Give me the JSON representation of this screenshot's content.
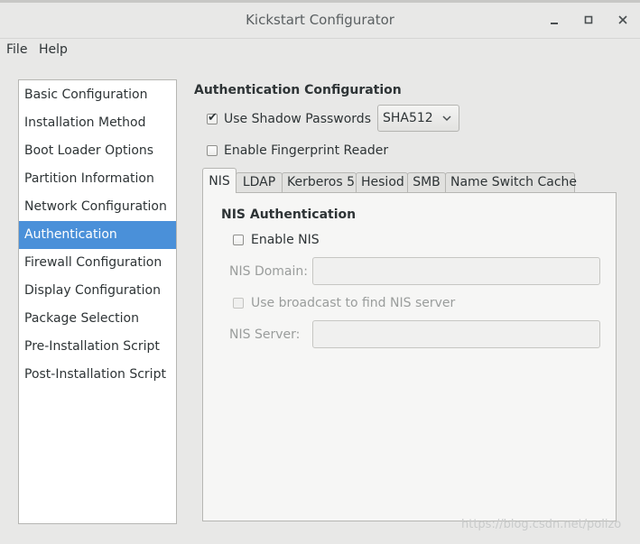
{
  "window": {
    "title": "Kickstart Configurator"
  },
  "menu": [
    "File",
    "Help"
  ],
  "sidebar": {
    "items": [
      {
        "label": "Basic Configuration",
        "selected": false
      },
      {
        "label": "Installation Method",
        "selected": false
      },
      {
        "label": "Boot Loader Options",
        "selected": false
      },
      {
        "label": "Partition Information",
        "selected": false
      },
      {
        "label": "Network Configuration",
        "selected": false
      },
      {
        "label": "Authentication",
        "selected": true
      },
      {
        "label": "Firewall Configuration",
        "selected": false
      },
      {
        "label": "Display Configuration",
        "selected": false
      },
      {
        "label": "Package Selection",
        "selected": false
      },
      {
        "label": "Pre-Installation Script",
        "selected": false
      },
      {
        "label": "Post-Installation Script",
        "selected": false
      }
    ]
  },
  "auth": {
    "heading": "Authentication Configuration",
    "shadow_label": "Use Shadow Passwords",
    "shadow_checked": true,
    "hash_value": "SHA512",
    "fingerprint_label": "Enable Fingerprint Reader",
    "fingerprint_checked": false
  },
  "tabs": [
    {
      "label": "NIS",
      "active": true
    },
    {
      "label": "LDAP",
      "active": false
    },
    {
      "label": "Kerberos 5",
      "active": false
    },
    {
      "label": "Hesiod",
      "active": false
    },
    {
      "label": "SMB",
      "active": false
    },
    {
      "label": "Name Switch Cache",
      "active": false
    }
  ],
  "nis": {
    "heading": "NIS Authentication",
    "enable_label": "Enable NIS",
    "enable_checked": false,
    "domain_label": "NIS Domain:",
    "domain_value": "",
    "broadcast_label": "Use broadcast to find NIS server",
    "server_label": "NIS Server:",
    "server_value": ""
  },
  "watermark": "https://blog.csdn.net/polizo",
  "colors": {
    "selection": "#4a90d9",
    "window_bg": "#e8e8e7"
  }
}
